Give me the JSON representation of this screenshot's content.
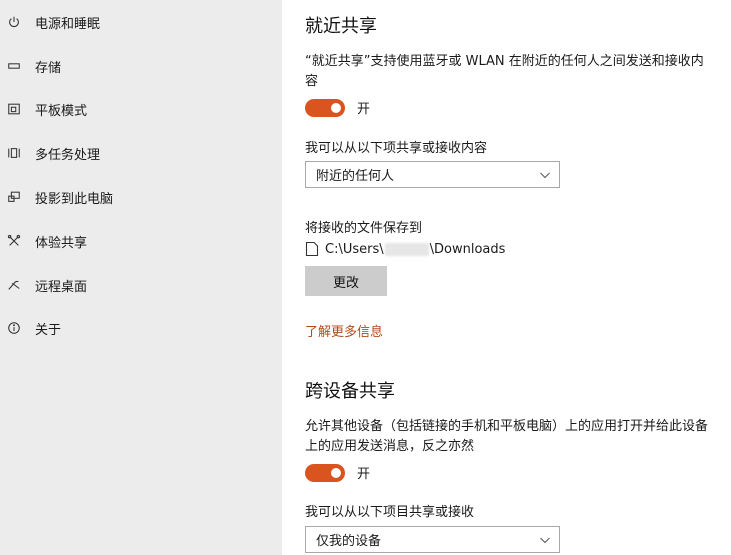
{
  "sidebar": {
    "items": [
      {
        "label": "电源和睡眠",
        "icon": "power-icon"
      },
      {
        "label": "存储",
        "icon": "storage-icon"
      },
      {
        "label": "平板模式",
        "icon": "tablet-mode-icon"
      },
      {
        "label": "多任务处理",
        "icon": "multitasking-icon"
      },
      {
        "label": "投影到此电脑",
        "icon": "project-icon"
      },
      {
        "label": "体验共享",
        "icon": "shared-experiences-icon"
      },
      {
        "label": "远程桌面",
        "icon": "remote-desktop-icon"
      },
      {
        "label": "关于",
        "icon": "info-icon"
      }
    ]
  },
  "nearby": {
    "title": "就近共享",
    "description": "“就近共享”支持使用蓝牙或 WLAN 在附近的任何人之间发送和接收内容",
    "toggle_label": "开",
    "toggle_on": true,
    "share_label": "我可以从以下项共享或接收内容",
    "share_value": "附近的任何人",
    "save_label": "将接收的文件保存到",
    "path_prefix": "C:\\Users\\",
    "path_suffix": "\\Downloads",
    "change_button": "更改",
    "learn_more": "了解更多信息"
  },
  "cross_device": {
    "title": "跨设备共享",
    "description": "允许其他设备（包括链接的手机和平板电脑）上的应用打开并给此设备上的应用发送消息，反之亦然",
    "toggle_label": "开",
    "toggle_on": true,
    "share_label": "我可以从以下项目共享或接收",
    "share_value": "仅我的设备"
  },
  "colors": {
    "accent": "#d9541e",
    "link": "#b14a1a",
    "sidebar_bg": "#ececec",
    "button_bg": "#cccccc"
  }
}
